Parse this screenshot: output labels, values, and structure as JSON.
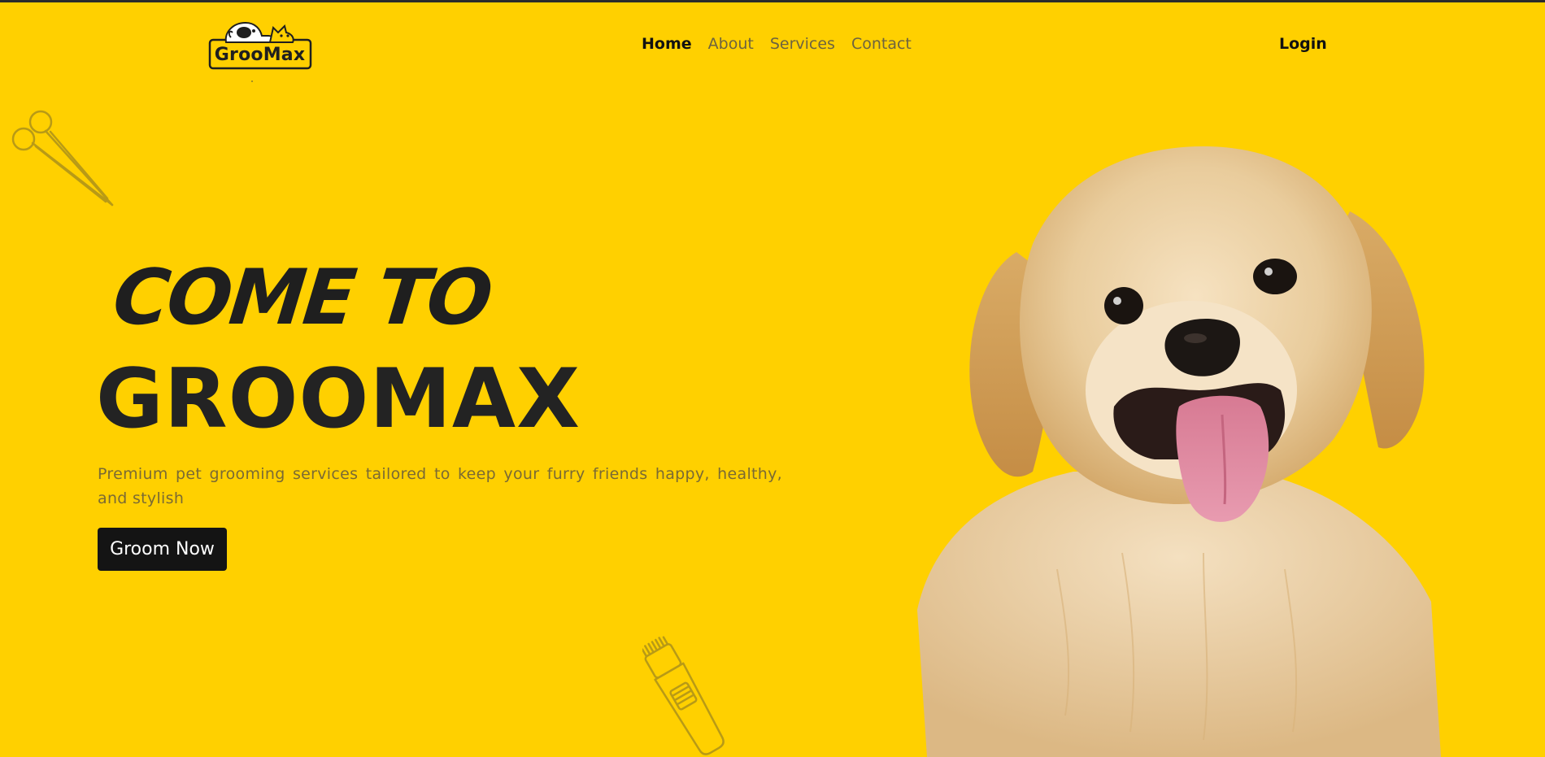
{
  "brand": {
    "logo_text": "GrooMax"
  },
  "nav": {
    "items": [
      {
        "label": "Home",
        "active": true
      },
      {
        "label": "About",
        "active": false
      },
      {
        "label": "Services",
        "active": false
      },
      {
        "label": "Contact",
        "active": false
      }
    ],
    "login_label": "Login"
  },
  "hero": {
    "script_heading": "COME TO",
    "title": "GROOMAX",
    "description": "Premium pet grooming services tailored to keep your furry friends happy, healthy, and stylish",
    "cta_label": "Groom Now"
  },
  "theme": {
    "background": "#FFD000",
    "text_dark": "#232323",
    "text_muted": "#7a6a34",
    "button_bg": "#141414",
    "button_text": "#ffffff"
  },
  "icons": {
    "decor_left": "scissors-icon",
    "decor_bottom": "clipper-icon",
    "logo": "dog-cat-logo-icon"
  }
}
